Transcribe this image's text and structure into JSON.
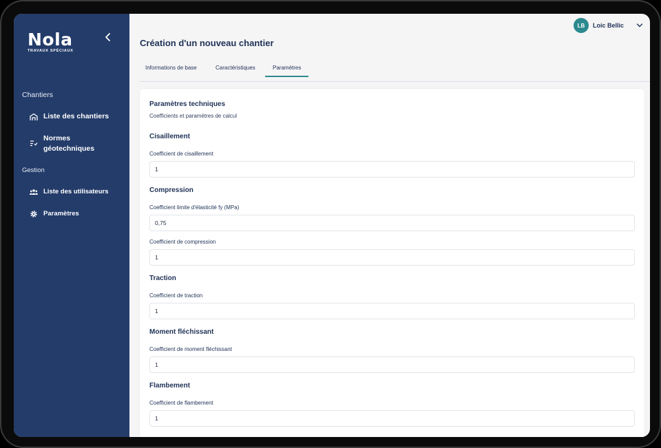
{
  "brand": {
    "name": "Nola",
    "tagline": "TRAVAUX SPÉCIAUX"
  },
  "sidebar": {
    "sections": [
      {
        "label": "Chantiers"
      },
      {
        "label": "Gestion"
      }
    ],
    "items": [
      {
        "label": "Liste des chantiers",
        "icon": "building-icon"
      },
      {
        "label_line1": "Normes",
        "label_line2": "géotechniques",
        "icon": "list-check-icon"
      },
      {
        "label": "Liste des utilisateurs",
        "icon": "users-icon"
      },
      {
        "label": "Paramètres",
        "icon": "gear-icon"
      }
    ]
  },
  "header": {
    "title": "Création d'un nouveau chantier",
    "user": {
      "initials": "LB",
      "name": "Loic Bellic"
    }
  },
  "tabs": [
    {
      "label": "Informations de base",
      "active": false
    },
    {
      "label": "Caractéristiques",
      "active": false
    },
    {
      "label": "Paramètres",
      "active": true
    }
  ],
  "form": {
    "title": "Paramètres techniques",
    "subtitle": "Coefficients et paramètres de calcul",
    "sections": [
      {
        "title": "Cisaillement",
        "fields": [
          {
            "label": "Coefficient de cisaillement",
            "value": "1"
          }
        ]
      },
      {
        "title": "Compression",
        "fields": [
          {
            "label": "Coefficient limite d'élasticité fy (MPa)",
            "value": "0,75"
          },
          {
            "label": "Coefficient de compression",
            "value": "1"
          }
        ]
      },
      {
        "title": "Traction",
        "fields": [
          {
            "label": "Coefficient de traction",
            "value": "1"
          }
        ]
      },
      {
        "title": "Moment fléchissant",
        "fields": [
          {
            "label": "Coefficient de moment fléchissant",
            "value": "1"
          }
        ]
      },
      {
        "title": "Flambement",
        "fields": [
          {
            "label": "Coefficient de flambement",
            "value": "1"
          }
        ]
      }
    ]
  },
  "colors": {
    "sidebar": "#243c6a",
    "accent": "#2c8a8f",
    "text": "#1f3256"
  }
}
